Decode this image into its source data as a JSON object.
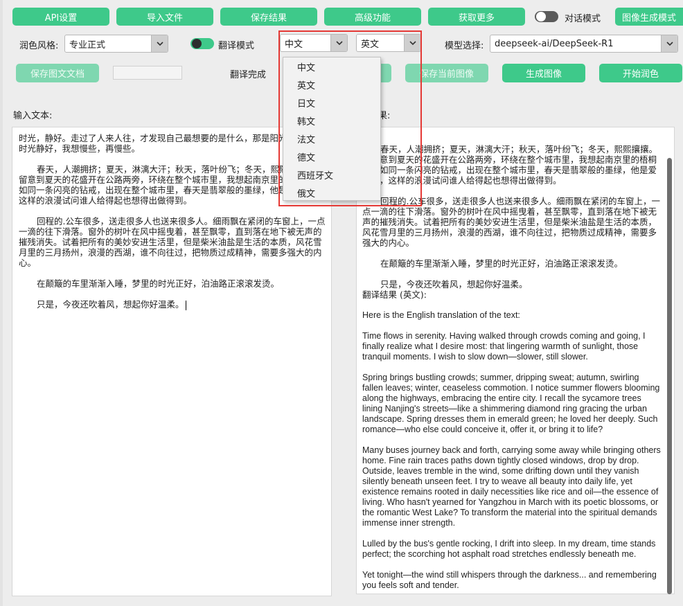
{
  "toolbar": {
    "api_settings": "API设置",
    "import_file": "导入文件",
    "save_result": "保存结果",
    "advanced": "高级功能",
    "get_more": "获取更多",
    "chat_mode": "对话模式",
    "image_gen_mode": "图像生成模式"
  },
  "options": {
    "style_label": "润色风格:",
    "style_value": "专业正式",
    "translate_mode": "翻译模式",
    "source_lang": "中文",
    "target_lang": "英文",
    "model_label": "模型选择:",
    "model_value": "deepseek-ai/DeepSeek-R1"
  },
  "actions": {
    "save_doc": "保存图文文档",
    "status": "翻译完成",
    "save_image": "保存当前图像",
    "gen_image": "生成图像",
    "start_polish": "开始润色"
  },
  "input": {
    "label": "输入文本:",
    "paragraphs": [
      "时光，静好。走过了人来人往，才发现自己最想要的是什么，那是阳光的温热，时光静好，我想慢些，再慢些。",
      "春天，人潮拥挤；夏天，淋漓大汗；秋天，落叶纷飞；冬天，熙熙攘攘。我留意到夏天的花盛开在公路两旁，环绕在整个城市里，我想起南京里的梧桐树，如同一条闪亮的钻戒，出现在整个城市里，春天是翡翠般的墨绿，他是爱她的，这样的浪漫试问谁人给得起也想得出做得到。",
      "回程的.公车很多，送走很多人也送来很多人。细雨飘在紧闭的车窗上，一点一滴的往下滑落。窗外的树叶在风中摇曳着，甚至飘零，直到落在地下被无声的摧残消失。试着把所有的美妙安进生活里，但是柴米油盐是生活的本质，风花雪月里的三月扬州，浪漫的西湖，谁不向往过，把物质过成精神，需要多强大的内心。",
      "在颠簸的车里渐渐入睡，梦里的时光正好，泊油路正滚滚发烫。",
      "只是，今夜还吹着风，想起你好温柔。"
    ]
  },
  "output": {
    "label": "结果:",
    "cn_paragraphs": [
      "春天，人潮拥挤；夏天，淋漓大汗；秋天，落叶纷飞；冬天，熙熙攘攘。我留意到夏天的花盛开在公路两旁，环绕在整个城市里，我想起南京里的梧桐树，如同一条闪亮的钻戒，出现在整个城市里，春天是翡翠般的墨绿，他是爱她的，这样的浪漫试问谁人给得起也想得出做得到。",
      "回程的.公车很多，送走很多人也送来很多人。细雨飘在紧闭的车窗上，一点一滴的往下滑落。窗外的树叶在风中摇曳着，甚至飘零，直到落在地下被无声的摧残消失。试着把所有的美妙安进生活里，但是柴米油盐是生活的本质，风花雪月里的三月扬州，浪漫的西湖，谁不向往过，把物质过成精神，需要多强大的内心。",
      "在颠簸的车里渐渐入睡，梦里的时光正好，泊油路正滚滚发烫。",
      "只是，今夜还吹着风，想起你好温柔。"
    ],
    "translation_header": "翻译结果 (英文):",
    "en_intro": "Here is the English translation of the text:",
    "en_paragraphs": [
      "Time flows in serenity. Having walked through crowds coming and going, I finally realize what I desire most: that lingering warmth of sunlight, those tranquil moments. I wish to slow down—slower, still slower.",
      "Spring brings bustling crowds; summer, dripping sweat; autumn, swirling fallen leaves; winter, ceaseless commotion. I notice summer flowers blooming along the highways, embracing the entire city. I recall the sycamore trees lining Nanjing's streets—like a shimmering diamond ring gracing the urban landscape. Spring dresses them in emerald green; he loved her deeply. Such romance—who else could conceive it, offer it, or bring it to life?",
      "Many buses journey back and forth, carrying some away while bringing others home. Fine rain traces paths down tightly closed windows, drop by drop. Outside, leaves tremble in the wind, some drifting down until they vanish silently beneath unseen feet. I try to weave all beauty into daily life, yet existence remains rooted in daily necessities like rice and oil—the essence of living. Who hasn't yearned for Yangzhou in March with its poetic blossoms, or the romantic West Lake? To transform the material into the spiritual demands immense inner strength.",
      "Lulled by the bus's gentle rocking, I drift into sleep. In my dream, time stands perfect; the scorching hot asphalt road stretches endlessly beneath me.",
      "Yet tonight—the wind still whispers through the darkness... and remembering you feels soft and tender."
    ]
  },
  "language_dropdown": {
    "items": [
      "中文",
      "英文",
      "日文",
      "韩文",
      "法文",
      "德文",
      "西班牙文",
      "俄文"
    ]
  },
  "colors": {
    "accent": "#3ec98a",
    "highlight": "#e53935"
  }
}
